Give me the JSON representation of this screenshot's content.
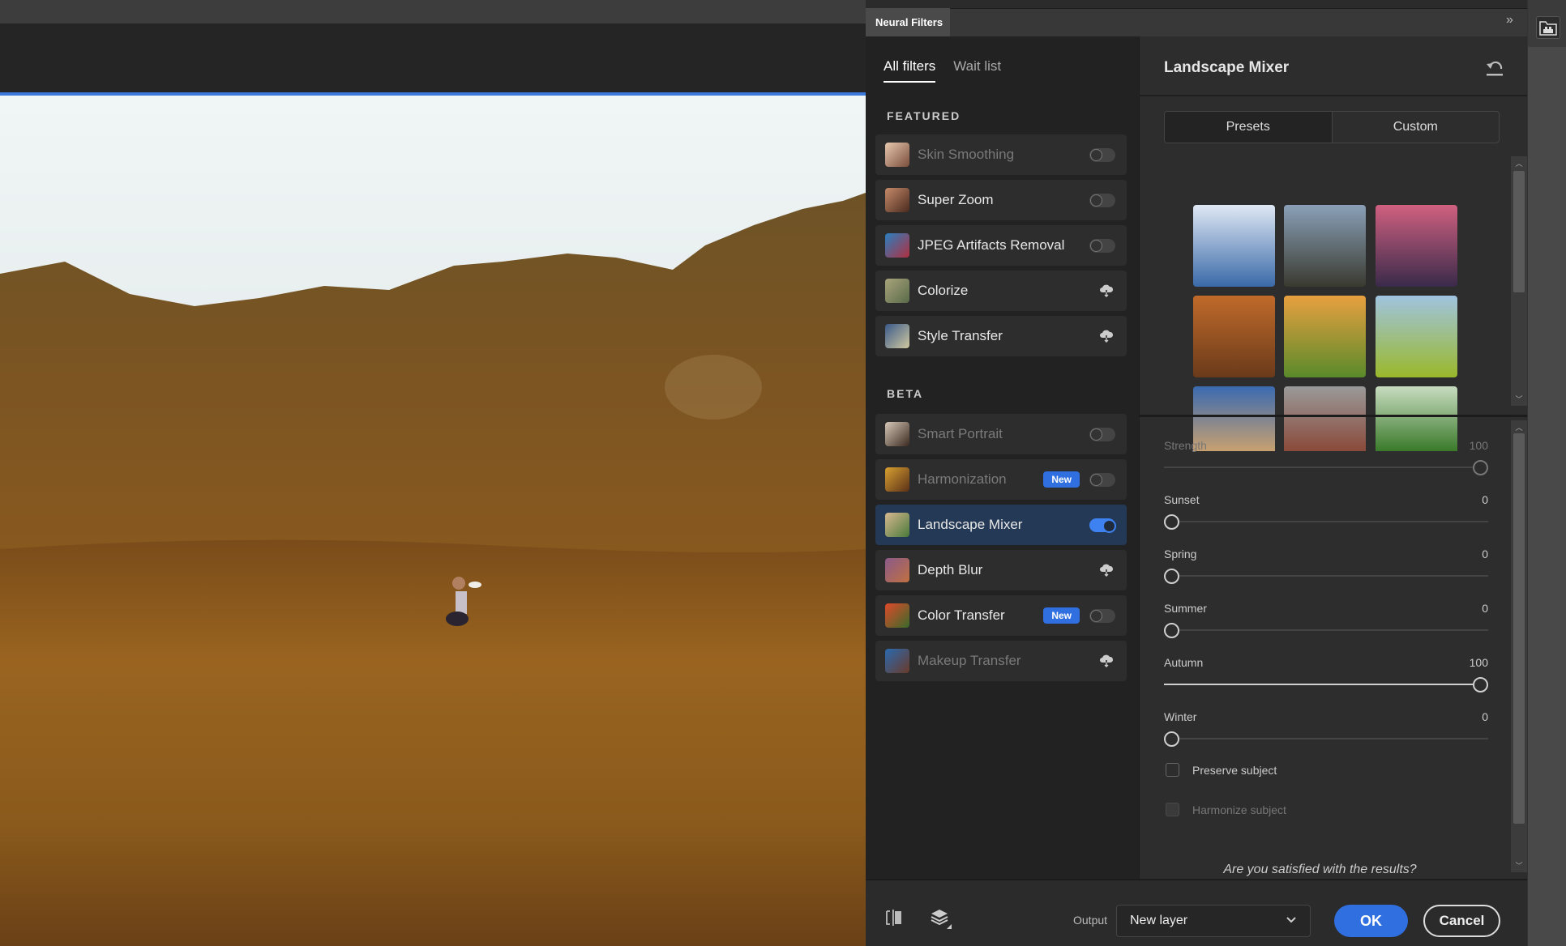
{
  "panel": {
    "title": "Neural Filters",
    "collapse_glyph": "»"
  },
  "tabs": [
    {
      "label": "All filters",
      "active": true
    },
    {
      "label": "Wait list",
      "active": false
    }
  ],
  "sections": {
    "featured": "FEATURED",
    "beta": "BETA"
  },
  "filters": [
    {
      "name": "Skin Smoothing",
      "control": "toggle",
      "on": false,
      "dim": true,
      "badge": null,
      "thumb": [
        "#e8c8b0",
        "#7a4e3a"
      ]
    },
    {
      "name": "Super Zoom",
      "control": "toggle",
      "on": false,
      "dim": false,
      "badge": null,
      "thumb": [
        "#c68a6a",
        "#4a2a1e"
      ]
    },
    {
      "name": "JPEG Artifacts Removal",
      "control": "toggle",
      "on": false,
      "dim": false,
      "badge": null,
      "thumb": [
        "#2a7fc0",
        "#b03040"
      ]
    },
    {
      "name": "Colorize",
      "control": "download",
      "on": false,
      "dim": false,
      "badge": null,
      "thumb": [
        "#a8a47a",
        "#5a6a4a"
      ]
    },
    {
      "name": "Style Transfer",
      "control": "download",
      "on": false,
      "dim": false,
      "badge": null,
      "thumb": [
        "#3a5a8a",
        "#d0c8a0"
      ]
    },
    {
      "name": "Smart Portrait",
      "control": "toggle",
      "on": false,
      "dim": true,
      "badge": null,
      "thumb": [
        "#d8c8b8",
        "#3a2a20"
      ]
    },
    {
      "name": "Harmonization",
      "control": "toggle",
      "on": false,
      "dim": true,
      "badge": "New",
      "thumb": [
        "#d8a030",
        "#5a3018"
      ]
    },
    {
      "name": "Landscape Mixer",
      "control": "toggle",
      "on": true,
      "dim": false,
      "badge": null,
      "selected": true,
      "thumb": [
        "#d8b890",
        "#4a7a3a"
      ]
    },
    {
      "name": "Depth Blur",
      "control": "download",
      "on": false,
      "dim": false,
      "badge": null,
      "thumb": [
        "#8a5a8a",
        "#c07040"
      ]
    },
    {
      "name": "Color Transfer",
      "control": "toggle",
      "on": false,
      "dim": false,
      "badge": "New",
      "thumb": [
        "#e04a2a",
        "#3a6a2a"
      ]
    },
    {
      "name": "Makeup Transfer",
      "control": "download",
      "on": false,
      "dim": true,
      "badge": null,
      "thumb": [
        "#2a6ab0",
        "#6a3a2a"
      ]
    }
  ],
  "detail": {
    "title": "Landscape Mixer",
    "segments": [
      {
        "label": "Presets",
        "active": true
      },
      {
        "label": "Custom",
        "active": false
      }
    ],
    "presets": [
      {
        "name": "snowy-mountain-lake",
        "colors": [
          "#dfe8f4",
          "#3a6aa8"
        ]
      },
      {
        "name": "mountain-river-valley",
        "colors": [
          "#8aa0b8",
          "#3a3a30"
        ]
      },
      {
        "name": "sunset-mountain-reflection",
        "colors": [
          "#d06080",
          "#3a2a4a"
        ]
      },
      {
        "name": "canyon",
        "colors": [
          "#c06a2a",
          "#6a3a1a"
        ]
      },
      {
        "name": "sunrise-green-hills",
        "colors": [
          "#e8a040",
          "#5a8a2a"
        ]
      },
      {
        "name": "alpine-meadow",
        "colors": [
          "#a0c4e0",
          "#9ab82a"
        ]
      },
      {
        "name": "desert-cliffs",
        "colors": [
          "#3a6ab0",
          "#c8a070"
        ]
      },
      {
        "name": "monument-valley",
        "colors": [
          "#9a9a9a",
          "#8a4a3a"
        ]
      },
      {
        "name": "green-river-valley",
        "colors": [
          "#c8dcc0",
          "#3a7a2a"
        ]
      }
    ],
    "sliders": [
      {
        "label": "Strength",
        "value": 100,
        "max": 100,
        "dim": true
      },
      {
        "label": "Sunset",
        "value": 0,
        "max": 100,
        "dim": false
      },
      {
        "label": "Spring",
        "value": 0,
        "max": 100,
        "dim": false
      },
      {
        "label": "Summer",
        "value": 0,
        "max": 100,
        "dim": false
      },
      {
        "label": "Autumn",
        "value": 100,
        "max": 100,
        "dim": false
      },
      {
        "label": "Winter",
        "value": 0,
        "max": 100,
        "dim": false
      }
    ],
    "checkboxes": [
      {
        "label": "Preserve subject",
        "checked": false,
        "disabled": false
      },
      {
        "label": "Harmonize subject",
        "checked": false,
        "disabled": true
      }
    ],
    "feedback_prompt": "Are you satisfied with the results?"
  },
  "footer": {
    "output_label": "Output",
    "output_value": "New layer",
    "ok_label": "OK",
    "cancel_label": "Cancel"
  },
  "colors": {
    "accent": "#2f6fe0",
    "selected_row": "#243955",
    "toggle_on": "#3d82f0"
  },
  "icons": {
    "cloud_download": "cloud-download-icon",
    "reset": "reset-icon",
    "compare": "before-after-icon",
    "layers": "layers-icon",
    "libraries": "libraries-icon"
  }
}
